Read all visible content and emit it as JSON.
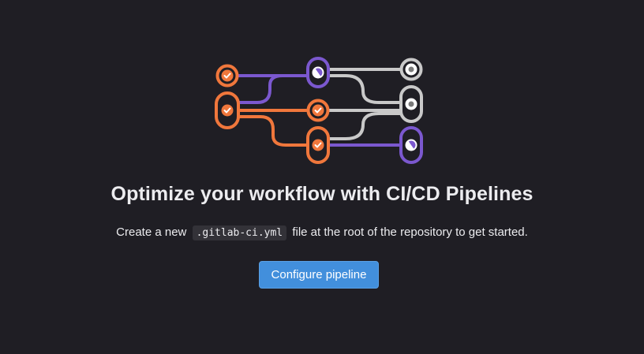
{
  "empty_state": {
    "title": "Optimize your workflow with CI/CD Pipelines",
    "description_prefix": "Create a new",
    "code_filename": ".gitlab-ci.yml",
    "description_suffix": "file at the root of the repository to get started.",
    "button_label": "Configure pipeline"
  },
  "colors": {
    "background": "#1f1e24",
    "orange": "#f0773c",
    "purple": "#7b58cf",
    "gray": "#c9c9c9",
    "button": "#428fdc"
  },
  "illustration": {
    "icons": [
      "check-icon",
      "check-icon",
      "check-icon",
      "check-icon",
      "running-icon",
      "running-icon",
      "pending-icon",
      "pending-icon"
    ]
  }
}
